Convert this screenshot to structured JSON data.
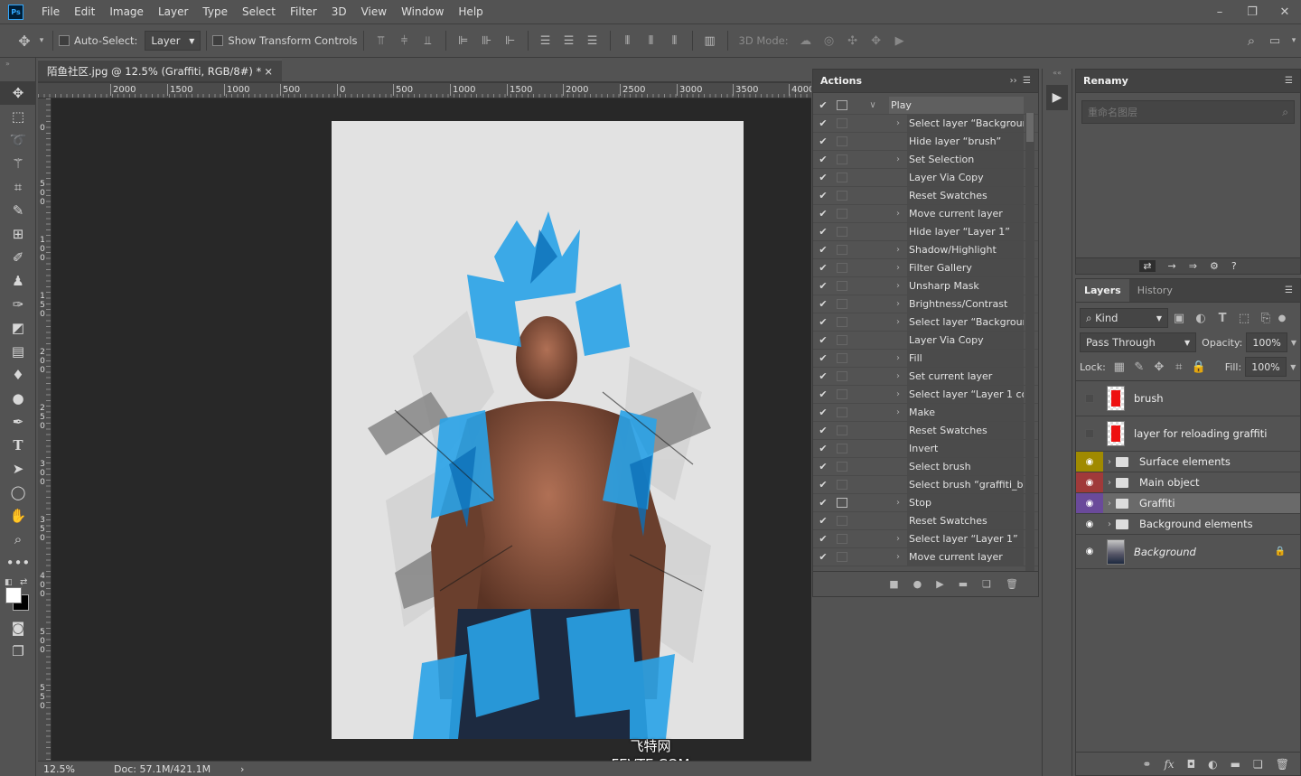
{
  "menubar": {
    "app_icon": "Ps",
    "items": [
      "File",
      "Edit",
      "Image",
      "Layer",
      "Type",
      "Select",
      "Filter",
      "3D",
      "View",
      "Window",
      "Help"
    ],
    "window_controls": [
      "minimize-icon",
      "restore-icon",
      "close-icon"
    ]
  },
  "options": {
    "auto_select_label": "Auto-Select:",
    "auto_select_value": "Layer",
    "transform_label": "Show Transform Controls",
    "mode_label": "3D Mode:"
  },
  "document_tab": {
    "title": "陌鱼社区.jpg @ 12.5% (Graffiti, RGB/8#) *",
    "close": "×"
  },
  "ruler": {
    "top_labels": [
      "2000",
      "1500",
      "1000",
      "500",
      "0",
      "500",
      "1000",
      "1500",
      "2000",
      "2500",
      "3000",
      "3500",
      "4000"
    ],
    "left_labels": [
      "0",
      "500",
      "100",
      "150",
      "200",
      "250",
      "300",
      "350",
      "400",
      "500",
      "550"
    ]
  },
  "status": {
    "zoom": "12.5%",
    "doc": "Doc: 57.1M/421.1M",
    "arrow": "›"
  },
  "watermark": {
    "line1": "飞特网",
    "line2": "FEVTE.COM"
  },
  "actions_panel": {
    "title": "Actions",
    "play_item": "Play",
    "items": [
      {
        "label": "Select layer “Background”",
        "expandable": true
      },
      {
        "label": "Hide layer “brush”",
        "expandable": false
      },
      {
        "label": "Set Selection",
        "expandable": true
      },
      {
        "label": "Layer Via Copy",
        "expandable": false
      },
      {
        "label": "Reset Swatches",
        "expandable": false
      },
      {
        "label": "Move current layer",
        "expandable": true
      },
      {
        "label": "Hide layer “Layer 1”",
        "expandable": false
      },
      {
        "label": "Shadow/Highlight",
        "expandable": true
      },
      {
        "label": "Filter Gallery",
        "expandable": true
      },
      {
        "label": "Unsharp Mask",
        "expandable": true
      },
      {
        "label": "Brightness/Contrast",
        "expandable": true
      },
      {
        "label": "Select layer “Background”",
        "expandable": true
      },
      {
        "label": "Layer Via Copy",
        "expandable": false
      },
      {
        "label": "Fill",
        "expandable": true
      },
      {
        "label": "Set current layer",
        "expandable": true
      },
      {
        "label": "Select layer “Layer 1 co...",
        "expandable": true
      },
      {
        "label": "Make",
        "expandable": true
      },
      {
        "label": "Reset Swatches",
        "expandable": false
      },
      {
        "label": "Invert",
        "expandable": false
      },
      {
        "label": "Select brush",
        "expandable": false
      },
      {
        "label": "Select brush “graffiti_br...",
        "expandable": false
      },
      {
        "label": "Stop",
        "expandable": true,
        "dialog": true
      },
      {
        "label": "Reset Swatches",
        "expandable": false
      },
      {
        "label": "Select layer “Layer 1”",
        "expandable": true
      },
      {
        "label": "Move current layer",
        "expandable": true
      }
    ]
  },
  "renamy_panel": {
    "title": "Renamy",
    "search_placeholder": "重命名图层"
  },
  "layers_panel": {
    "tabs": [
      "Layers",
      "History"
    ],
    "kind_label": "Kind",
    "blend_mode": "Pass Through",
    "opacity_label": "Opacity:",
    "opacity_value": "100%",
    "lock_label": "Lock:",
    "fill_label": "Fill:",
    "fill_value": "100%",
    "layers": [
      {
        "name": "brush",
        "type": "pixel",
        "visible": false,
        "color": ""
      },
      {
        "name": "layer for reloading graffiti",
        "type": "pixel",
        "visible": false,
        "color": ""
      },
      {
        "name": "Surface elements",
        "type": "group",
        "visible": true,
        "color": "#a08a00"
      },
      {
        "name": "Main object",
        "type": "group",
        "visible": true,
        "color": "#a03a3a"
      },
      {
        "name": "Graffiti",
        "type": "group",
        "visible": true,
        "color": "#6a4a9a"
      },
      {
        "name": "Background elements",
        "type": "group",
        "visible": true,
        "color": ""
      },
      {
        "name": "Background",
        "type": "background",
        "visible": true,
        "color": ""
      }
    ]
  }
}
